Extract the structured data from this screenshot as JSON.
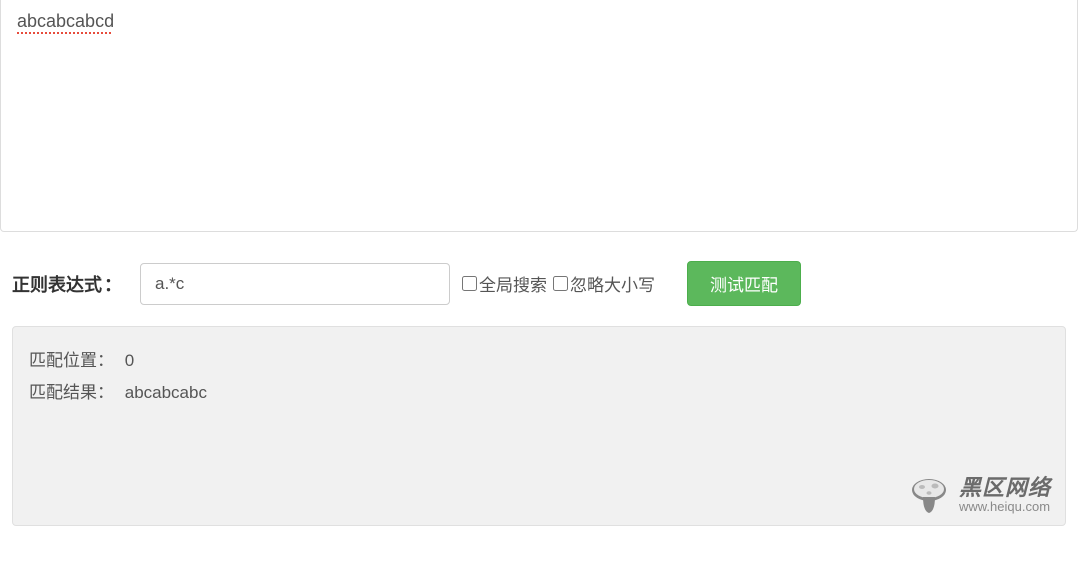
{
  "input": {
    "test_string": "abcabcabcd"
  },
  "regex": {
    "label": "正则表达式",
    "colon": "：",
    "pattern": "a.*c",
    "global_search": "全局搜索",
    "ignore_case": "忽略大小写",
    "test_button": "测试匹配"
  },
  "result": {
    "position_label": "匹配位置：",
    "position_value": "0",
    "match_label": "匹配结果：",
    "match_value": "abcabcabc"
  },
  "watermark": {
    "title": "黑区网络",
    "url": "www.heiqu.com"
  }
}
